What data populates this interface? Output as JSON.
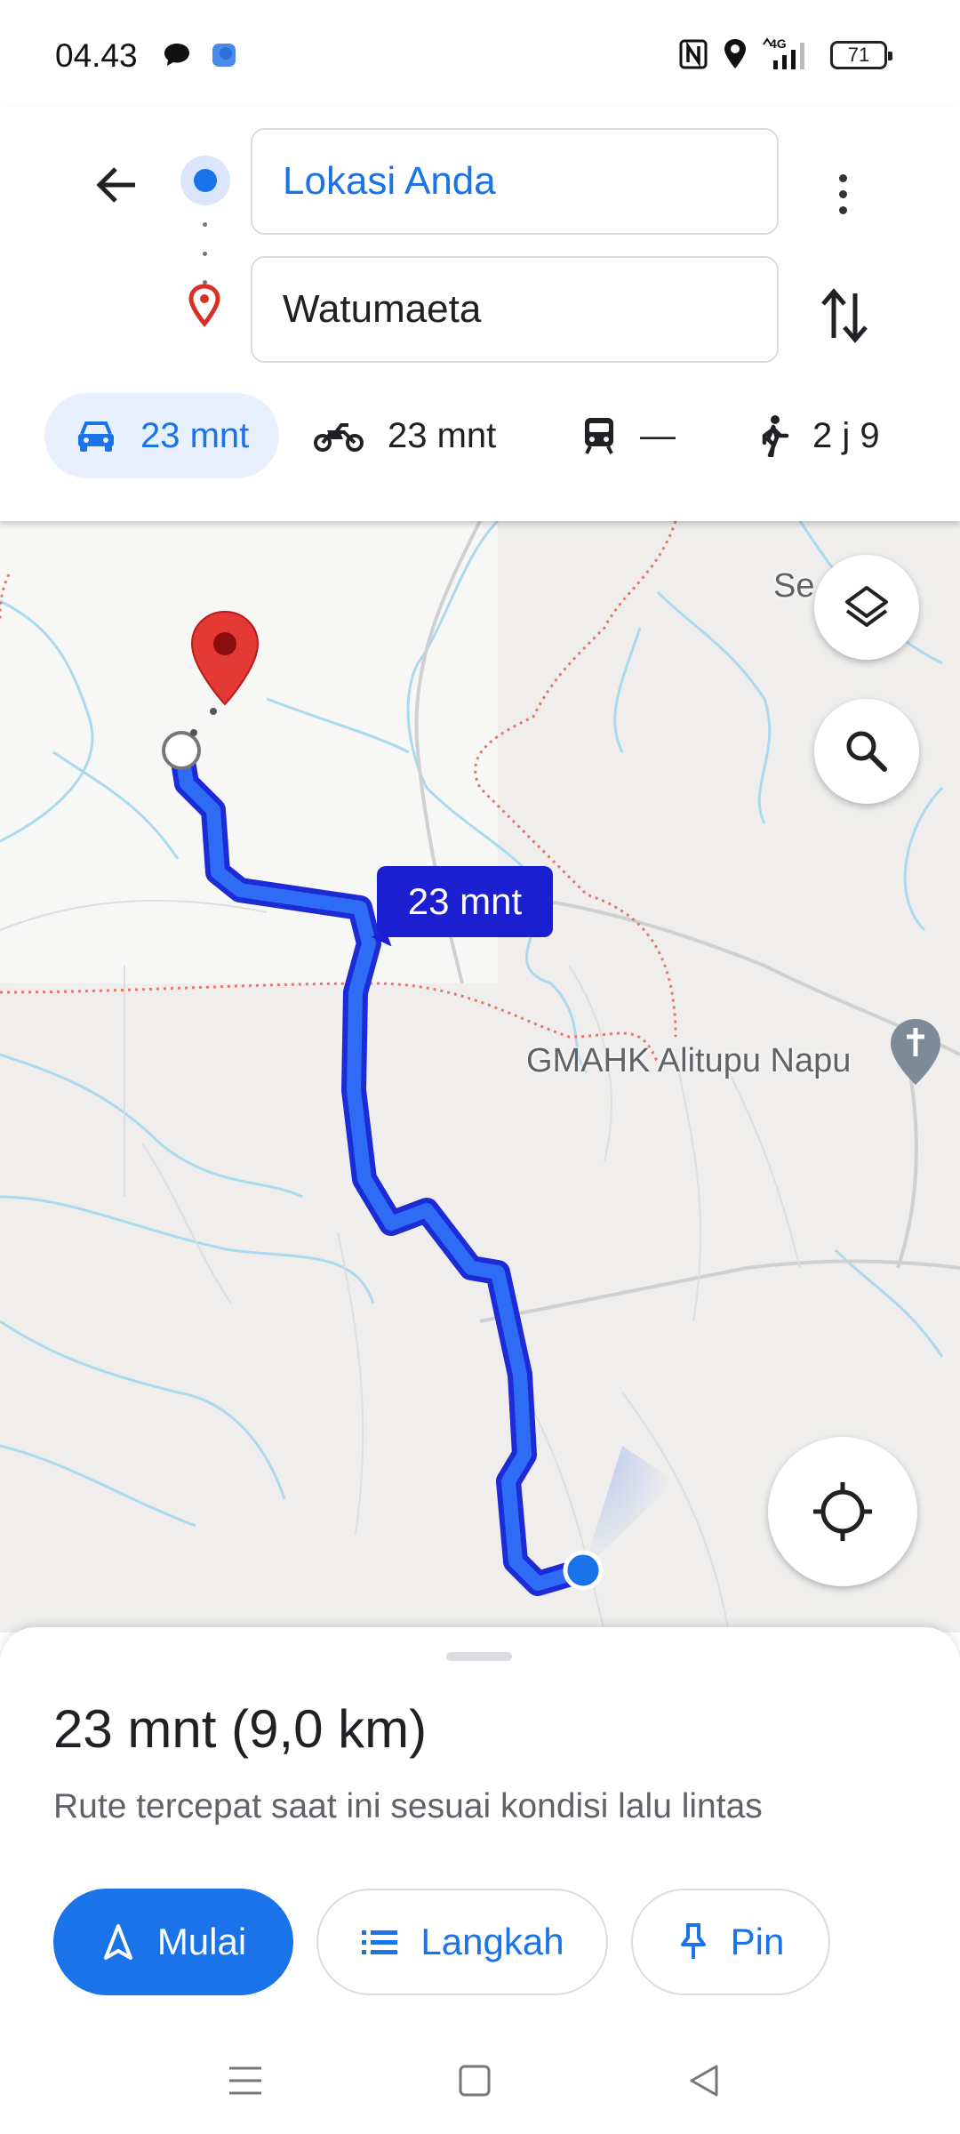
{
  "status_bar": {
    "time": "04.43",
    "battery": "71",
    "network": "4G",
    "icons": [
      "chat-bubble-icon",
      "app-icon",
      "nfc-icon",
      "location-icon",
      "signal-icon",
      "battery-icon"
    ]
  },
  "directions": {
    "origin": "Lokasi Anda",
    "destination": "Watumaeta",
    "modes": [
      {
        "name": "car",
        "icon": "car-icon",
        "label": "23 mnt",
        "selected": true
      },
      {
        "name": "motorcycle",
        "icon": "motorcycle-icon",
        "label": "23 mnt",
        "selected": false
      },
      {
        "name": "transit",
        "icon": "train-icon",
        "label": "—",
        "selected": false
      },
      {
        "name": "walk",
        "icon": "walking-icon",
        "label": "2 j 9",
        "selected": false
      }
    ]
  },
  "map": {
    "route_label": "23 mnt",
    "place_label_partial": "Se",
    "poi_label": "GMAHK Alitupu Napu",
    "route_color": "#1a1fd0"
  },
  "sheet": {
    "duration": "23 mnt (9,0 km)",
    "subtitle": "Rute tercepat saat ini sesuai kondisi lalu lintas",
    "start_label": "Mulai",
    "steps_label": "Langkah",
    "pin_label": "Pin"
  },
  "colors": {
    "accent": "#1a73e8",
    "destination_pin": "#d93025",
    "route_line": "#1a1fd0"
  }
}
